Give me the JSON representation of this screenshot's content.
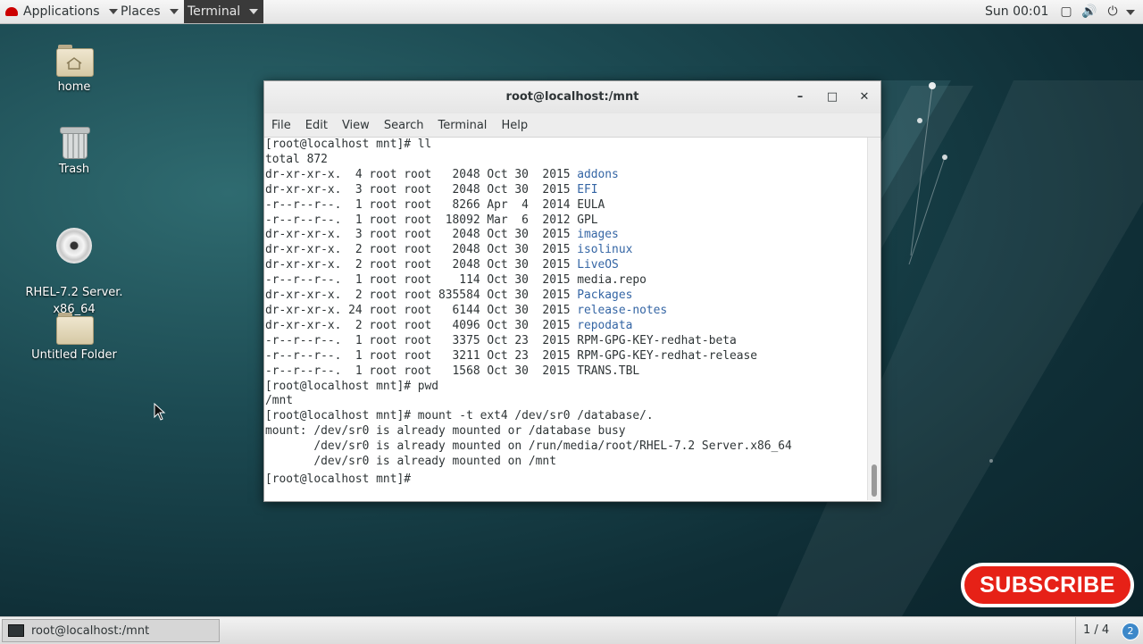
{
  "topbar": {
    "applications": "Applications",
    "places": "Places",
    "terminal": "Terminal",
    "clock": "Sun 00:01",
    "icons": [
      "window-icon",
      "volume-icon",
      "power-icon",
      "chevron-down-icon"
    ]
  },
  "desktop": {
    "icons": [
      {
        "label": "home",
        "icon": "home-folder-icon"
      },
      {
        "label": "Trash",
        "icon": "trash-icon"
      },
      {
        "label": "RHEL-7.2 Server.\nx86_64",
        "icon": "disc-icon"
      },
      {
        "label": "Untitled Folder",
        "icon": "folder-icon"
      }
    ]
  },
  "window": {
    "title": "root@localhost:/mnt",
    "controls": {
      "minimize": "–",
      "maximize": "□",
      "close": "✕"
    },
    "menu": [
      "File",
      "Edit",
      "View",
      "Search",
      "Terminal",
      "Help"
    ]
  },
  "terminal": {
    "lines": [
      {
        "text": "[root@localhost mnt]# ll"
      },
      {
        "text": "total 872"
      },
      {
        "text": "dr-xr-xr-x.  4 root root   2048 Oct 30  2015 ",
        "link": "addons"
      },
      {
        "text": "dr-xr-xr-x.  3 root root   2048 Oct 30  2015 ",
        "link": "EFI"
      },
      {
        "text": "-r--r--r--.  1 root root   8266 Apr  4  2014 EULA"
      },
      {
        "text": "-r--r--r--.  1 root root  18092 Mar  6  2012 GPL"
      },
      {
        "text": "dr-xr-xr-x.  3 root root   2048 Oct 30  2015 ",
        "link": "images"
      },
      {
        "text": "dr-xr-xr-x.  2 root root   2048 Oct 30  2015 ",
        "link": "isolinux"
      },
      {
        "text": "dr-xr-xr-x.  2 root root   2048 Oct 30  2015 ",
        "link": "LiveOS"
      },
      {
        "text": "-r--r--r--.  1 root root    114 Oct 30  2015 media.repo"
      },
      {
        "text": "dr-xr-xr-x.  2 root root 835584 Oct 30  2015 ",
        "link": "Packages"
      },
      {
        "text": "dr-xr-xr-x. 24 root root   6144 Oct 30  2015 ",
        "link": "release-notes"
      },
      {
        "text": "dr-xr-xr-x.  2 root root   4096 Oct 30  2015 ",
        "link": "repodata"
      },
      {
        "text": "-r--r--r--.  1 root root   3375 Oct 23  2015 RPM-GPG-KEY-redhat-beta"
      },
      {
        "text": "-r--r--r--.  1 root root   3211 Oct 23  2015 RPM-GPG-KEY-redhat-release"
      },
      {
        "text": "-r--r--r--.  1 root root   1568 Oct 30  2015 TRANS.TBL"
      },
      {
        "text": "[root@localhost mnt]# pwd"
      },
      {
        "text": "/mnt"
      },
      {
        "text": "[root@localhost mnt]# mount -t ext4 /dev/sr0 /database/."
      },
      {
        "text": "mount: /dev/sr0 is already mounted or /database busy"
      },
      {
        "text": "       /dev/sr0 is already mounted on /run/media/root/RHEL-7.2 Server.x86_64"
      },
      {
        "text": "       /dev/sr0 is already mounted on /mnt"
      },
      {
        "text": "[root@localhost mnt]# "
      }
    ],
    "link_color": "#3465a4"
  },
  "subscribe": {
    "label": "SUBSCRIBE",
    "color": "#e62117"
  },
  "bottombar": {
    "task": "root@localhost:/mnt",
    "workspace": "1 / 4",
    "notifications": "2"
  }
}
